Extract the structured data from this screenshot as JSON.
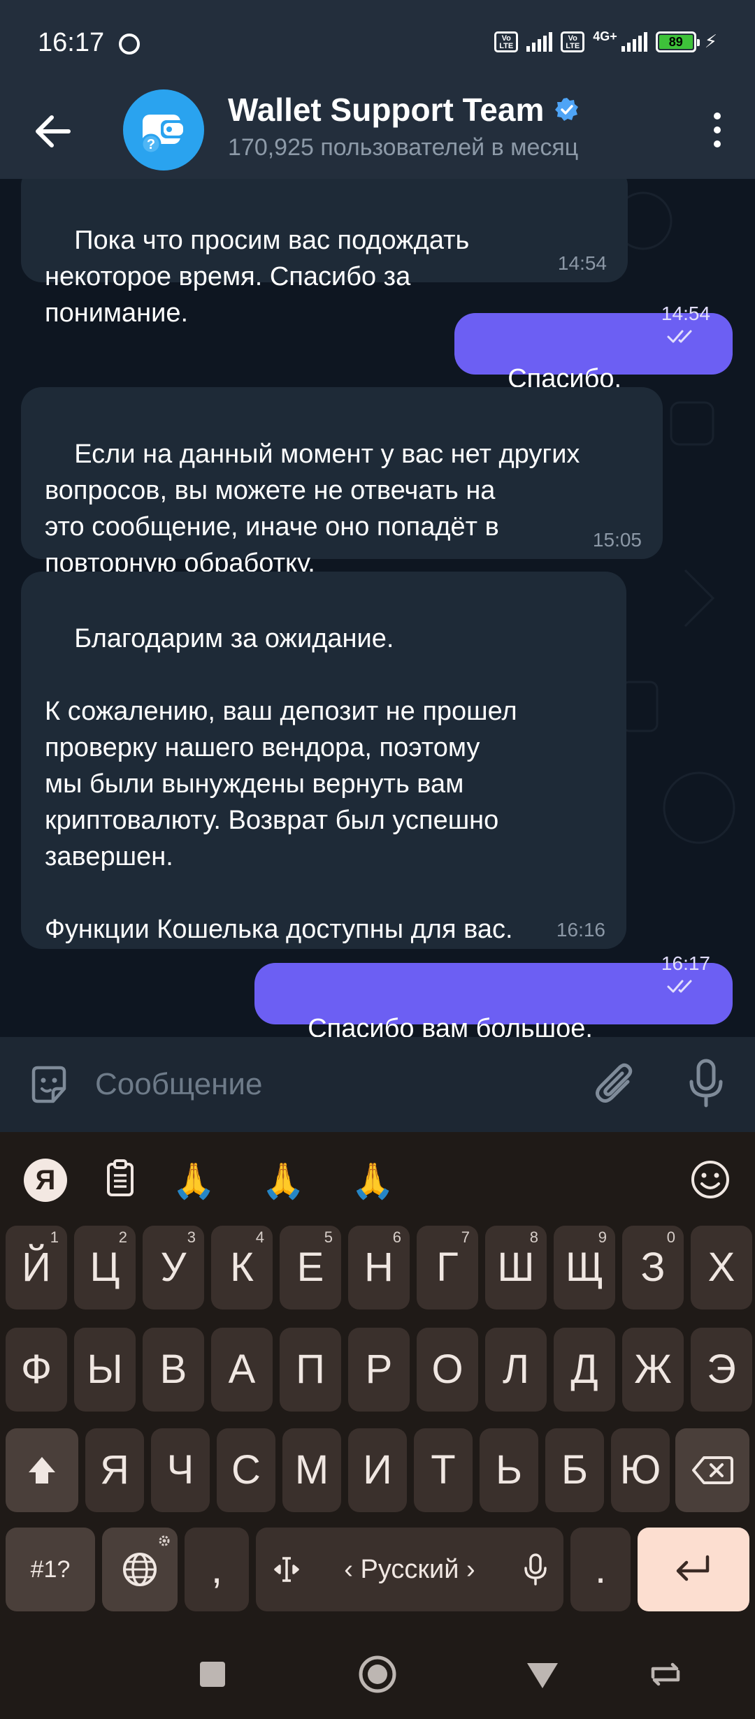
{
  "status_bar": {
    "time": "16:17",
    "volte1": "Vo\nLTE",
    "volte2": "Vo\nLTE",
    "network": "4G+",
    "battery": "89",
    "battery_color": "#3ec23a"
  },
  "header": {
    "title": "Wallet Support Team",
    "subtitle": "170,925 пользователей в месяц",
    "verified_color": "#4ea4f6",
    "avatar_color": "#2aa3ef"
  },
  "messages": [
    {
      "direction": "in",
      "text": "Пока что просим вас подождать\nнекоторое время. Спасибо за\nпонимание.",
      "time": "14:54"
    },
    {
      "direction": "out",
      "text": "Спасибо.",
      "time": "14:54",
      "status": "read"
    },
    {
      "direction": "in",
      "text": "Если на данный момент у вас нет других\nвопросов, вы можете не отвечать на\nэто сообщение, иначе оно попадёт в\nповторную обработку.",
      "time": "15:05"
    },
    {
      "direction": "in",
      "text": "Благодарим за ожидание.\n\nК сожалению, ваш депозит не прошел\nпроверку нашего вендора, поэтому\nмы были вынуждены вернуть вам\nкриптовалюту. Возврат был успешно\nзавершен.\n\nФункции Кошелька доступны для вас.",
      "time": "16:16"
    },
    {
      "direction": "out",
      "text": "Спасибо вам большое.",
      "time": "16:17",
      "status": "read"
    }
  ],
  "composer": {
    "placeholder": "Сообщение"
  },
  "keyboard": {
    "logo": "Я",
    "suggestions": [
      "🙏",
      "🙏",
      "🙏"
    ],
    "row1": [
      {
        "k": "Й",
        "n": "1"
      },
      {
        "k": "Ц",
        "n": "2"
      },
      {
        "k": "У",
        "n": "3"
      },
      {
        "k": "К",
        "n": "4"
      },
      {
        "k": "Е",
        "n": "5"
      },
      {
        "k": "Н",
        "n": "6"
      },
      {
        "k": "Г",
        "n": "7"
      },
      {
        "k": "Ш",
        "n": "8"
      },
      {
        "k": "Щ",
        "n": "9"
      },
      {
        "k": "З",
        "n": "0"
      },
      {
        "k": "Х",
        "n": ""
      }
    ],
    "row2": [
      "Ф",
      "Ы",
      "В",
      "А",
      "П",
      "Р",
      "О",
      "Л",
      "Д",
      "Ж",
      "Э"
    ],
    "row3": [
      "Я",
      "Ч",
      "С",
      "М",
      "И",
      "Т",
      "Ь",
      "Б",
      "Ю"
    ],
    "symbols_label": "#1?",
    "comma": ",",
    "space_label": "Русский",
    "period": "."
  },
  "icons": {
    "back": "arrow-left-icon",
    "menu": "more-vertical-icon",
    "emoji": "sticker-smile-icon",
    "attach": "paperclip-icon",
    "mic": "microphone-icon",
    "clipboard": "clipboard-icon",
    "globe": "globe-icon",
    "shift": "shift-icon",
    "backspace": "backspace-icon",
    "enter": "enter-icon"
  }
}
